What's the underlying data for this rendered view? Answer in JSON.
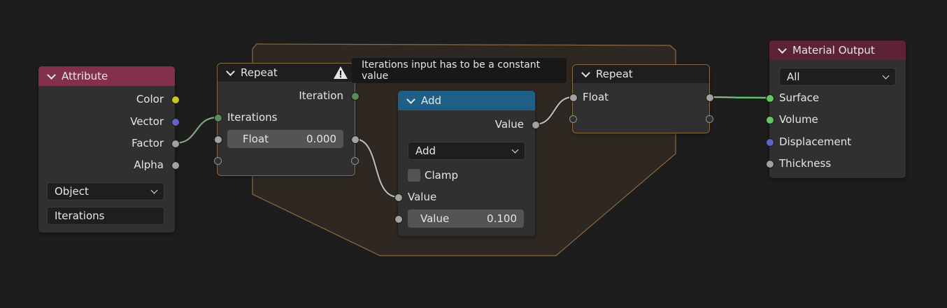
{
  "colors": {
    "background": "#1d1d1d",
    "node_body": "#303030",
    "attribute_header": "#83314a",
    "repeat_header": "#1e1e1e",
    "add_header": "#1f5f86",
    "output_header": "#5e2237",
    "zone_fill": "#2f2822",
    "zone_border": "#8a6a40",
    "socket_color": "#c7c729",
    "socket_vector": "#6363c7",
    "socket_float": "#a1a1a1",
    "socket_int": "#598c5c",
    "socket_shader": "#63c763"
  },
  "tooltip": {
    "text": "Iterations input has to be a constant value",
    "icon": "warning-icon"
  },
  "attribute_node": {
    "title": "Attribute",
    "outputs": [
      {
        "label": "Color",
        "socket": "color"
      },
      {
        "label": "Vector",
        "socket": "vector"
      },
      {
        "label": "Factor",
        "socket": "float"
      },
      {
        "label": "Alpha",
        "socket": "float"
      }
    ],
    "type_dropdown": "Object",
    "name_field": "Iterations"
  },
  "repeat_input_node": {
    "title": "Repeat",
    "iteration_output": "Iteration",
    "iterations_input": "Iterations",
    "float_field": {
      "label": "Float",
      "value": "0.000"
    }
  },
  "add_node": {
    "title": "Add",
    "output": "Value",
    "operation": "Add",
    "clamp_label": "Clamp",
    "input_label": "Value",
    "value_field": {
      "label": "Value",
      "value": "0.100"
    }
  },
  "repeat_output_node": {
    "title": "Repeat",
    "float_label": "Float"
  },
  "material_output_node": {
    "title": "Material Output",
    "target_dropdown": "All",
    "inputs": [
      {
        "label": "Surface",
        "socket": "shader"
      },
      {
        "label": "Volume",
        "socket": "shader"
      },
      {
        "label": "Displacement",
        "socket": "vector"
      },
      {
        "label": "Thickness",
        "socket": "float"
      }
    ]
  }
}
